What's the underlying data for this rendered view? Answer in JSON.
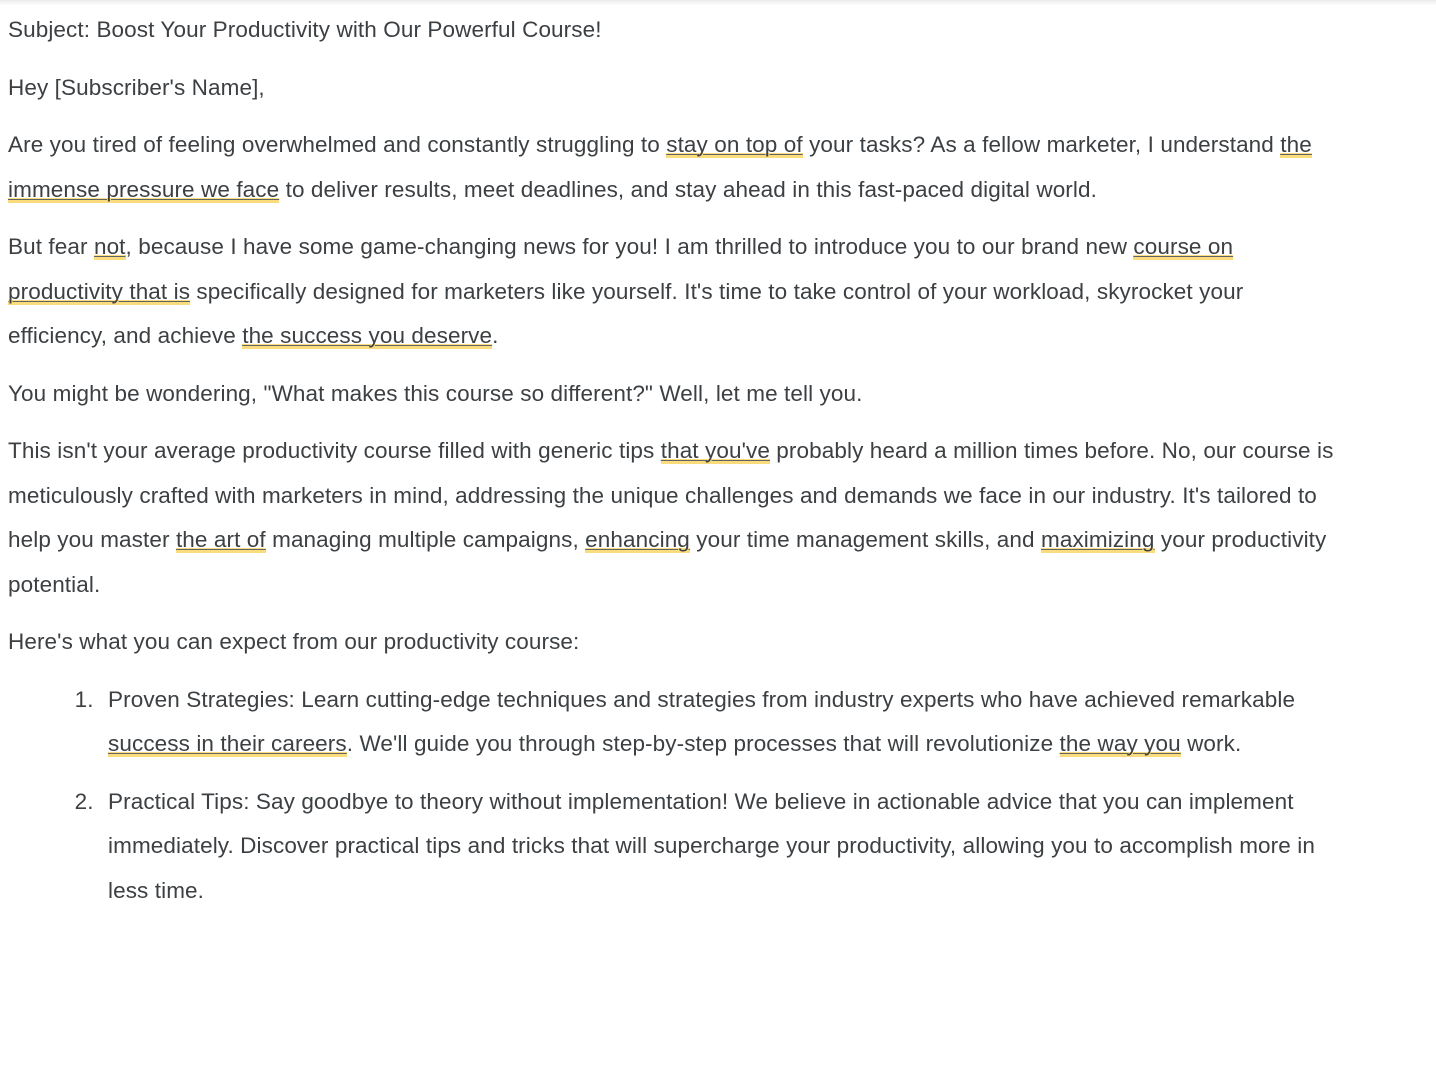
{
  "theme": {
    "background": "#ffffff",
    "text_color": "#3c4043",
    "highlight_color": "#fbdc7d",
    "underline_color": "#5f6368"
  },
  "email": {
    "subject_line": "Subject: Boost Your Productivity with Our Powerful Course!",
    "greeting": "Hey [Subscriber's Name],",
    "paragraph_1": {
      "part_a": "Are you tired of feeling overwhelmed and constantly struggling to ",
      "highlight_1": "stay on top of",
      "part_b": " your tasks? As a fellow marketer, I understand ",
      "highlight_2": "the immense pressure we face",
      "part_c": " to deliver results, meet deadlines, and stay ahead in this fast-paced digital world."
    },
    "paragraph_2": {
      "part_a": "But fear ",
      "highlight_1": "not",
      "part_b": ", because I have some game-changing news for you! I am thrilled to introduce you to our brand new ",
      "highlight_2": "course on productivity that is",
      "part_c": " specifically designed for marketers like yourself. It's time to take control of your workload, skyrocket your efficiency, and achieve ",
      "highlight_3": "the success you deserve",
      "part_d": "."
    },
    "paragraph_3": "You might be wondering, \"What makes this course so different?\" Well, let me tell you.",
    "paragraph_4": {
      "part_a": "This isn't your average productivity course filled with generic tips ",
      "highlight_1": "that you've",
      "part_b": " probably heard a million times before. No, our course is meticulously crafted with marketers in mind, addressing the unique challenges and demands we face in our industry. It's tailored to help you master ",
      "highlight_2": "the art of",
      "part_c": " managing multiple campaigns, ",
      "highlight_3": "enhancing",
      "part_d": " your time management skills, and ",
      "highlight_4": "maximizing",
      "part_e": " your productivity potential."
    },
    "paragraph_5": "Here's what you can expect from our productivity course:",
    "list": [
      {
        "part_a": "Proven Strategies: Learn cutting-edge techniques and strategies from industry experts who have achieved remarkable ",
        "highlight_1": "success in their careers",
        "part_b": ". We'll guide you through step-by-step processes that will revolutionize ",
        "highlight_2": "the way you",
        "part_c": " work."
      },
      {
        "part_a": "Practical Tips: Say goodbye to theory without implementation! We believe in actionable advice that you can implement immediately. Discover practical tips and tricks that will supercharge your productivity, allowing you to accomplish more in less time.",
        "highlight_1": "",
        "part_b": "",
        "highlight_2": "",
        "part_c": ""
      }
    ]
  }
}
